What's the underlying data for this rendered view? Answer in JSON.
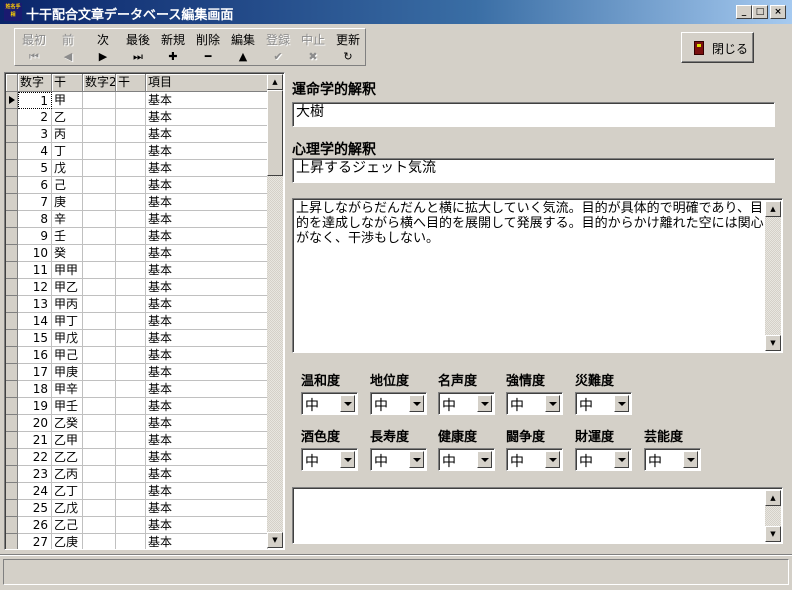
{
  "window": {
    "title": "十干配合文章データベース編集画面",
    "icon_text": "姓名手相",
    "minimize": "_",
    "maximize": "□",
    "close": "×"
  },
  "toolbar": {
    "first": {
      "label": "最初",
      "icon": "⏮"
    },
    "prev": {
      "label": "前",
      "icon": "◀"
    },
    "next": {
      "label": "次",
      "icon": "▶"
    },
    "last": {
      "label": "最後",
      "icon": "⏭"
    },
    "new": {
      "label": "新規",
      "icon": "✚"
    },
    "delete": {
      "label": "削除",
      "icon": "━"
    },
    "edit": {
      "label": "編集",
      "icon": "▲"
    },
    "save": {
      "label": "登録",
      "icon": "✔"
    },
    "cancel": {
      "label": "中止",
      "icon": "✖"
    },
    "refresh": {
      "label": "更新",
      "icon": "↻"
    },
    "close_label": "閉じる"
  },
  "grid": {
    "columns": [
      "数字",
      "干",
      "数字2",
      "干",
      "項目"
    ],
    "rows": [
      {
        "num": "1",
        "kan": "甲",
        "item": "基本"
      },
      {
        "num": "2",
        "kan": "乙",
        "item": "基本"
      },
      {
        "num": "3",
        "kan": "丙",
        "item": "基本"
      },
      {
        "num": "4",
        "kan": "丁",
        "item": "基本"
      },
      {
        "num": "5",
        "kan": "戊",
        "item": "基本"
      },
      {
        "num": "6",
        "kan": "己",
        "item": "基本"
      },
      {
        "num": "7",
        "kan": "庚",
        "item": "基本"
      },
      {
        "num": "8",
        "kan": "辛",
        "item": "基本"
      },
      {
        "num": "9",
        "kan": "壬",
        "item": "基本"
      },
      {
        "num": "10",
        "kan": "癸",
        "item": "基本"
      },
      {
        "num": "11",
        "kan": "甲甲",
        "item": "基本"
      },
      {
        "num": "12",
        "kan": "甲乙",
        "item": "基本"
      },
      {
        "num": "13",
        "kan": "甲丙",
        "item": "基本"
      },
      {
        "num": "14",
        "kan": "甲丁",
        "item": "基本"
      },
      {
        "num": "15",
        "kan": "甲戊",
        "item": "基本"
      },
      {
        "num": "16",
        "kan": "甲己",
        "item": "基本"
      },
      {
        "num": "17",
        "kan": "甲庚",
        "item": "基本"
      },
      {
        "num": "18",
        "kan": "甲辛",
        "item": "基本"
      },
      {
        "num": "19",
        "kan": "甲壬",
        "item": "基本"
      },
      {
        "num": "20",
        "kan": "乙癸",
        "item": "基本"
      },
      {
        "num": "21",
        "kan": "乙甲",
        "item": "基本"
      },
      {
        "num": "22",
        "kan": "乙乙",
        "item": "基本"
      },
      {
        "num": "23",
        "kan": "乙丙",
        "item": "基本"
      },
      {
        "num": "24",
        "kan": "乙丁",
        "item": "基本"
      },
      {
        "num": "25",
        "kan": "乙戊",
        "item": "基本"
      },
      {
        "num": "26",
        "kan": "乙己",
        "item": "基本"
      },
      {
        "num": "27",
        "kan": "乙庚",
        "item": "基本"
      }
    ]
  },
  "detail": {
    "fortune_title": "運命学的解釈",
    "fortune_value": "大樹",
    "psych_title": "心理学的解釈",
    "psych_value": "上昇するジェット気流",
    "memo": "上昇しながらだんだんと横に拡大していく気流。目的が具体的で明確であり、目的を達成しながら横へ目的を展開して発展する。目的からかけ離れた空には関心がなく、干渉もしない。"
  },
  "degrees": {
    "row1": [
      {
        "label": "温和度",
        "value": "中"
      },
      {
        "label": "地位度",
        "value": "中"
      },
      {
        "label": "名声度",
        "value": "中"
      },
      {
        "label": "強情度",
        "value": "中"
      },
      {
        "label": "災難度",
        "value": "中"
      }
    ],
    "row2": [
      {
        "label": "酒色度",
        "value": "中"
      },
      {
        "label": "長寿度",
        "value": "中"
      },
      {
        "label": "健康度",
        "value": "中"
      },
      {
        "label": "闘争度",
        "value": "中"
      },
      {
        "label": "財運度",
        "value": "中"
      },
      {
        "label": "芸能度",
        "value": "中"
      }
    ]
  },
  "scroll_arrows": {
    "up": "▲",
    "down": "▼"
  }
}
